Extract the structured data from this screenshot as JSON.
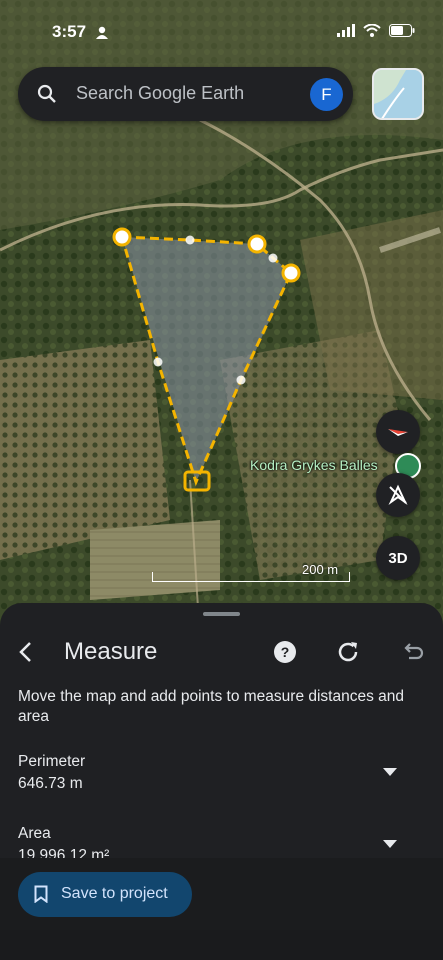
{
  "status": {
    "time": "3:57"
  },
  "search": {
    "placeholder": "Search Google Earth",
    "avatar_letter": "F"
  },
  "map": {
    "place_label": "Kodra Grykes Balles",
    "scale_label": "200 m",
    "btn_3d": "3D",
    "measure_color": "#f4b400"
  },
  "sheet": {
    "title": "Measure",
    "instruction": "Move the map and add points to measure distances and area",
    "perimeter_label": "Perimeter",
    "perimeter_value": "646.73 m",
    "area_label": "Area",
    "area_value": "19,996.12 m²",
    "save_label": "Save to project"
  },
  "icons": [
    "back-arrow-icon",
    "help-icon",
    "refresh-icon",
    "undo-icon",
    "bookmark-icon",
    "compass-icon",
    "tilt-off-icon",
    "search-icon"
  ]
}
